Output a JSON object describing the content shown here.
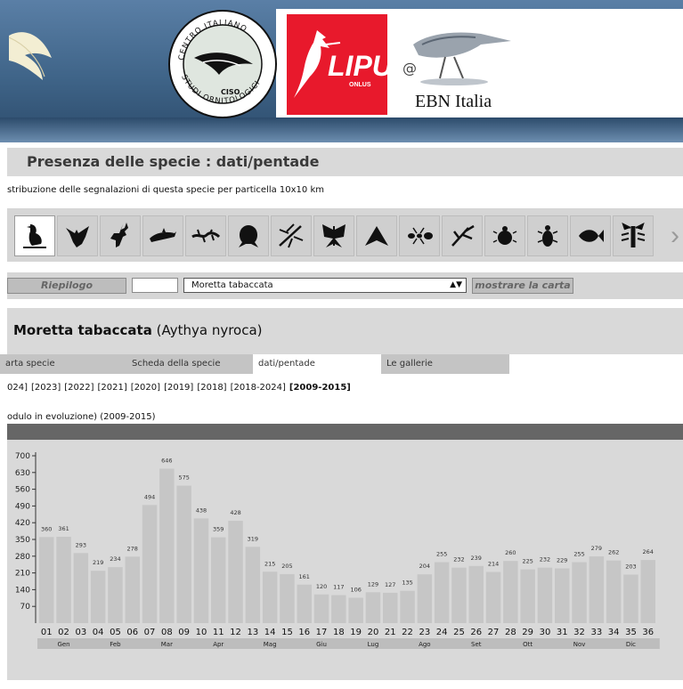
{
  "header": {
    "ciso_logo": "CENTRO ITALIANO STUDI ORNITOLOGICI",
    "ciso_abbrev": "CISO",
    "lipu_logo": "LIPU",
    "lipu_sub": "ONLUS",
    "ebn_logo": "EBN Italia"
  },
  "page_title": "Presenza delle specie : dati/pentade",
  "subtitle": "stribuzione delle segnalazioni di questa specie per particella 10x10 km",
  "iconbar": {
    "icons": [
      "bird-icon",
      "bat-icon",
      "deer-icon",
      "dolphin-icon",
      "lizard-icon",
      "frog-icon",
      "dragonfly-icon",
      "butterfly-icon",
      "moth-icon",
      "ant-icon",
      "mantis-icon",
      "ladybug-icon",
      "beetle-icon",
      "fish-icon",
      "crayfish-icon"
    ],
    "selected": 0,
    "more": "›"
  },
  "controls": {
    "riepilogo": "Riepilogo",
    "selected_species": "Moretta tabaccata",
    "show_map": "mostrare la carta"
  },
  "species": {
    "common": "Moretta tabaccata",
    "latin": "(Aythya nyroca)"
  },
  "tabs": [
    "arta specie",
    "Scheda della specie",
    "dati/pentade",
    "Le gallerie"
  ],
  "active_tab": 2,
  "years": [
    "024]",
    "[2023]",
    "[2022]",
    "[2021]",
    "[2020]",
    "[2019]",
    "[2018]",
    "[2018-2024]",
    "[2009-2015]"
  ],
  "current_year": "[2009-2015]",
  "module_note": "odulo in evoluzione) (2009-2015)",
  "colors": {
    "bar": "#c6c6c6",
    "chart_bg": "#d9d9d9",
    "axis": "#333333",
    "lipu_red": "#e8192c",
    "banner_blue": "#3f6488"
  },
  "chart_data": {
    "type": "bar",
    "title": "",
    "xlabel": "",
    "ylabel": "",
    "ylim": [
      0,
      700
    ],
    "yticks": [
      70,
      140,
      210,
      280,
      350,
      420,
      490,
      560,
      630,
      700
    ],
    "categories": [
      "01",
      "02",
      "03",
      "04",
      "05",
      "06",
      "07",
      "08",
      "09",
      "10",
      "11",
      "12",
      "13",
      "14",
      "15",
      "16",
      "17",
      "18",
      "19",
      "20",
      "21",
      "22",
      "23",
      "24",
      "25",
      "26",
      "27",
      "28",
      "29",
      "30",
      "31",
      "32",
      "33",
      "34",
      "35",
      "36"
    ],
    "values": [
      360,
      361,
      293,
      219,
      234,
      278,
      494,
      646,
      575,
      438,
      359,
      428,
      319,
      215,
      205,
      161,
      120,
      117,
      106,
      129,
      127,
      135,
      204,
      255,
      232,
      239,
      214,
      260,
      225,
      232,
      229,
      255,
      279,
      262,
      203,
      264
    ],
    "months": [
      {
        "label": "Gen",
        "center": 2
      },
      {
        "label": "Feb",
        "center": 5
      },
      {
        "label": "Mar",
        "center": 8
      },
      {
        "label": "Apr",
        "center": 11
      },
      {
        "label": "Mag",
        "center": 14
      },
      {
        "label": "Giu",
        "center": 17
      },
      {
        "label": "Lug",
        "center": 20
      },
      {
        "label": "Ago",
        "center": 23
      },
      {
        "label": "Set",
        "center": 26
      },
      {
        "label": "Ott",
        "center": 29
      },
      {
        "label": "Nov",
        "center": 32
      },
      {
        "label": "Dic",
        "center": 35
      }
    ],
    "grid": false,
    "legend": "none"
  }
}
